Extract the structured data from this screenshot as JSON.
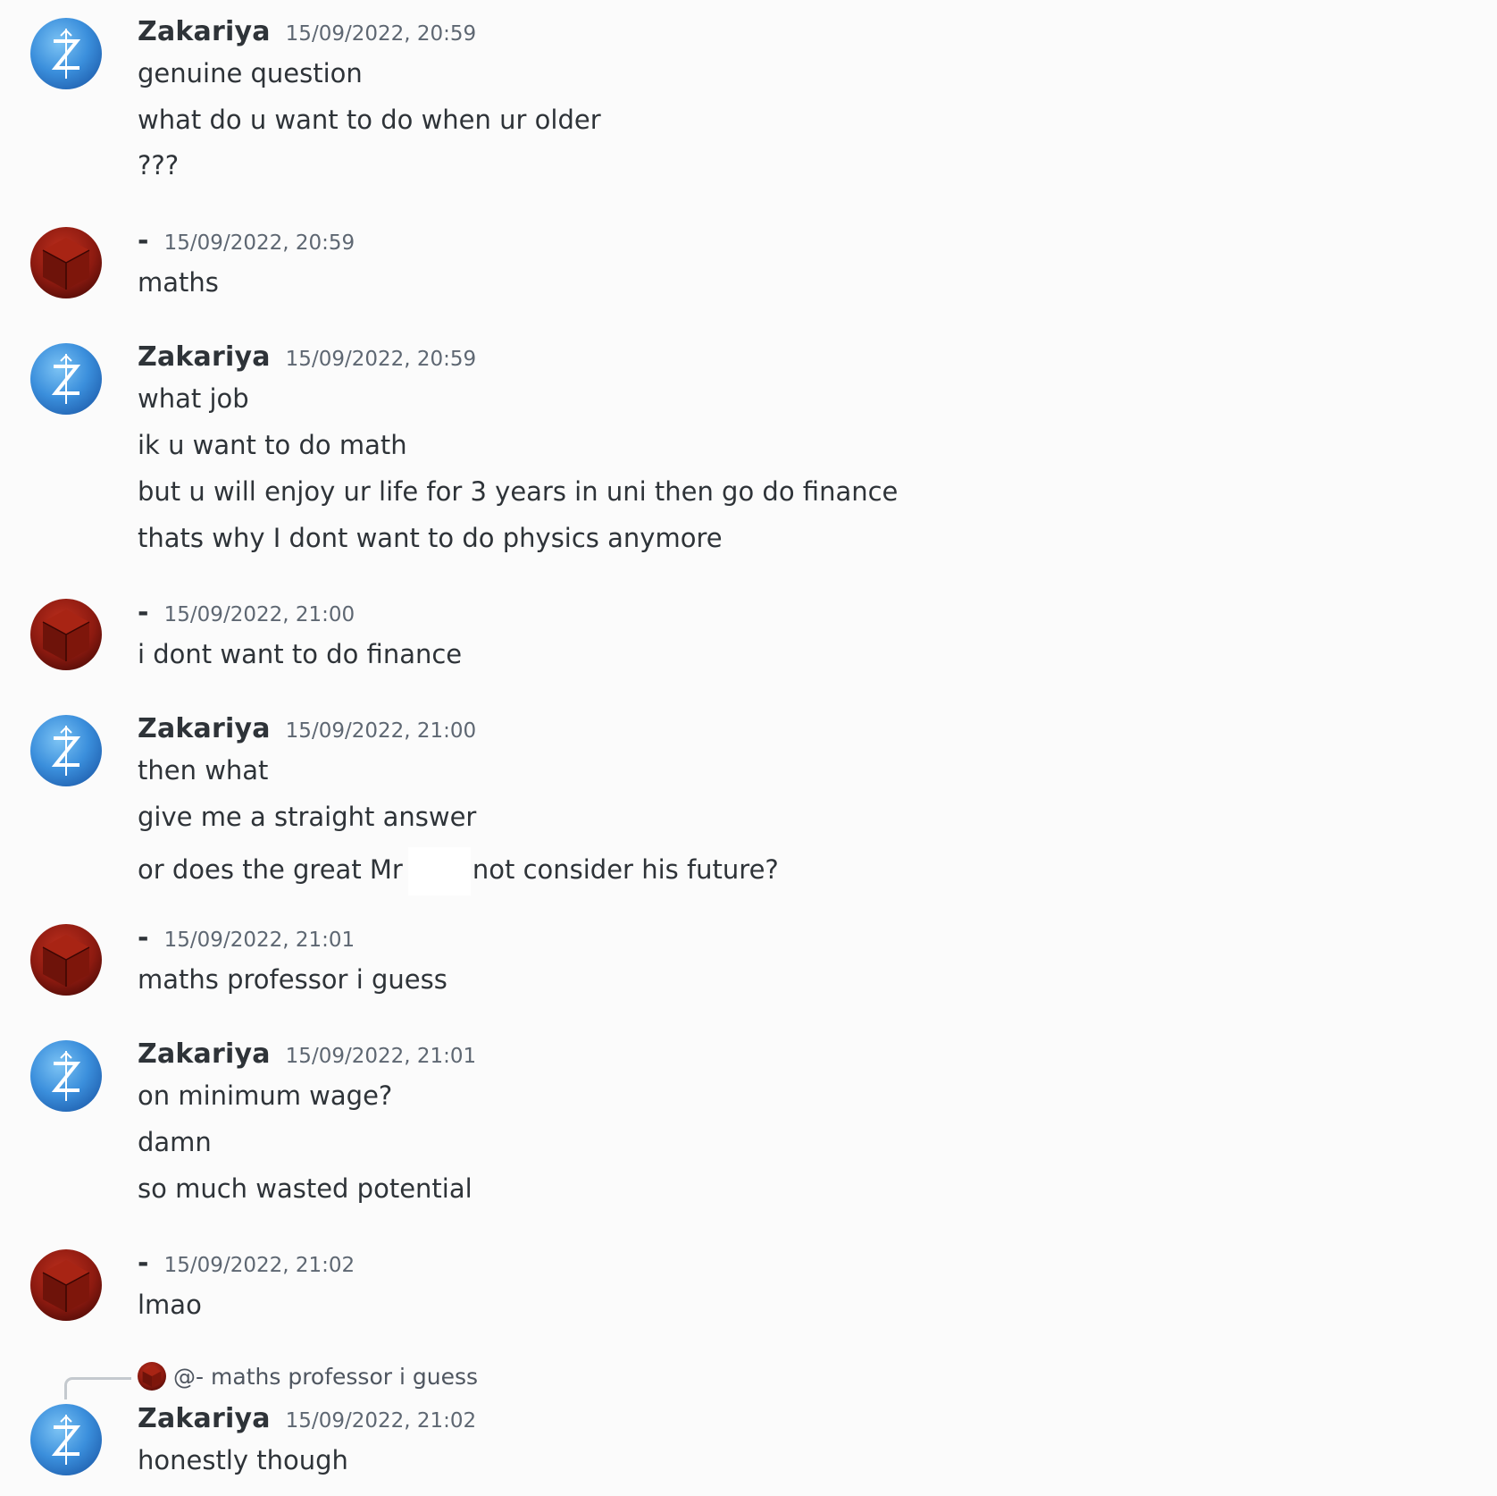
{
  "users": {
    "zakariya": {
      "name": "Zakariya",
      "avatar_icon": "zelda-z-avatar-icon",
      "avatar_color": "#3b8fdc"
    },
    "dash": {
      "name": "-",
      "avatar_icon": "red-cube-avatar-icon",
      "avatar_color": "#8c1a10"
    }
  },
  "messages": [
    {
      "author": "Zakariya",
      "timestamp": "15/09/2022, 20:59",
      "lines": [
        "genuine question",
        "what do u want to do when ur older",
        "???"
      ]
    },
    {
      "author": "-",
      "timestamp": "15/09/2022, 20:59",
      "lines": [
        "maths"
      ]
    },
    {
      "author": "Zakariya",
      "timestamp": "15/09/2022, 20:59",
      "lines": [
        "what job",
        "ik u want to do math",
        "but u will enjoy ur life for 3 years in uni then go do finance",
        "thats why I dont want to do physics anymore"
      ]
    },
    {
      "author": "-",
      "timestamp": "15/09/2022, 21:00",
      "lines": [
        "i dont want to do finance"
      ]
    },
    {
      "author": "Zakariya",
      "timestamp": "15/09/2022, 21:00",
      "lines": [
        "then what",
        "give me a straight answer"
      ],
      "redacted_line": {
        "before": "or does the great Mr",
        "after": "not consider his future?"
      }
    },
    {
      "author": "-",
      "timestamp": "15/09/2022, 21:01",
      "lines": [
        "maths professor i guess"
      ]
    },
    {
      "author": "Zakariya",
      "timestamp": "15/09/2022, 21:01",
      "lines": [
        "on minimum wage?",
        "damn",
        "so much wasted potential"
      ]
    },
    {
      "author": "-",
      "timestamp": "15/09/2022, 21:02",
      "lines": [
        "lmao"
      ]
    },
    {
      "author": "Zakariya",
      "timestamp": "15/09/2022, 21:02",
      "reply": {
        "mention": "@-",
        "text": "maths professor i guess"
      },
      "lines": [
        "honestly though"
      ]
    }
  ]
}
